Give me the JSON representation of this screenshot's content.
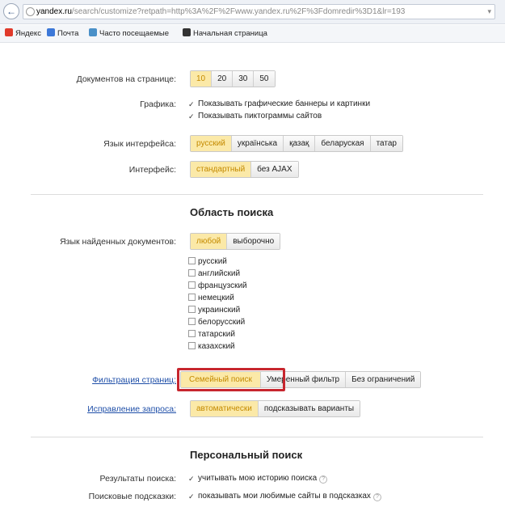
{
  "browser": {
    "url_host": "yandex.ru",
    "url_rest": "/search/customize?retpath=http%3A%2F%2Fwww.yandex.ru%2F%3Fdomredir%3D1&lr=193",
    "bookmarks": [
      {
        "label": "Яндекс",
        "icon": "yandex-icon",
        "color": "#e03a2b"
      },
      {
        "label": "Почта",
        "icon": "mail-icon",
        "color": "#3c78d8"
      },
      {
        "label": "Часто посещаемые",
        "icon": "frequent-icon",
        "color": "#4a90c8"
      },
      {
        "label": "Начальная страница",
        "icon": "start-page-icon",
        "color": "#333333"
      }
    ]
  },
  "settings": {
    "docs_per_page": {
      "label": "Документов на странице:",
      "options": [
        "10",
        "20",
        "30",
        "50"
      ],
      "selected": "10"
    },
    "graphics": {
      "label": "Графика:",
      "options": [
        "Показывать графические баннеры и картинки",
        "Показывать пиктограммы сайтов"
      ]
    },
    "ui_lang": {
      "label": "Язык интерфейса:",
      "options": [
        "русский",
        "українська",
        "қазақ",
        "беларуская",
        "татар"
      ],
      "selected": "русский"
    },
    "interface": {
      "label": "Интерфейс:",
      "options": [
        "стандартный",
        "без AJAX"
      ],
      "selected": "стандартный"
    }
  },
  "search_scope": {
    "title": "Область поиска",
    "doc_lang": {
      "label": "Язык найденных документов:",
      "options": [
        "любой",
        "выборочно"
      ],
      "selected": "любой"
    },
    "languages": [
      "русский",
      "английский",
      "французский",
      "немецкий",
      "украинский",
      "белорусский",
      "татарский",
      "казахский"
    ],
    "filter": {
      "label": "Фильтрация страниц:",
      "options": [
        "Семейный поиск",
        "Умеренный фильтр",
        "Без ограничений"
      ],
      "selected": "Семейный поиск"
    },
    "correction": {
      "label": "Исправление запроса:",
      "options": [
        "автоматически",
        "подсказывать варианты"
      ],
      "selected": "автоматически"
    }
  },
  "personal": {
    "title": "Персональный поиск",
    "results": {
      "label": "Результаты поиска:",
      "option": "учитывать мою историю поиска"
    },
    "suggest": {
      "label": "Поисковые подсказки:",
      "option": "показывать мои любимые сайты в подсказках"
    }
  },
  "colors": {
    "active_segment": "#fbe9a8",
    "link": "#1f4fa8",
    "highlight": "#c7262e"
  }
}
